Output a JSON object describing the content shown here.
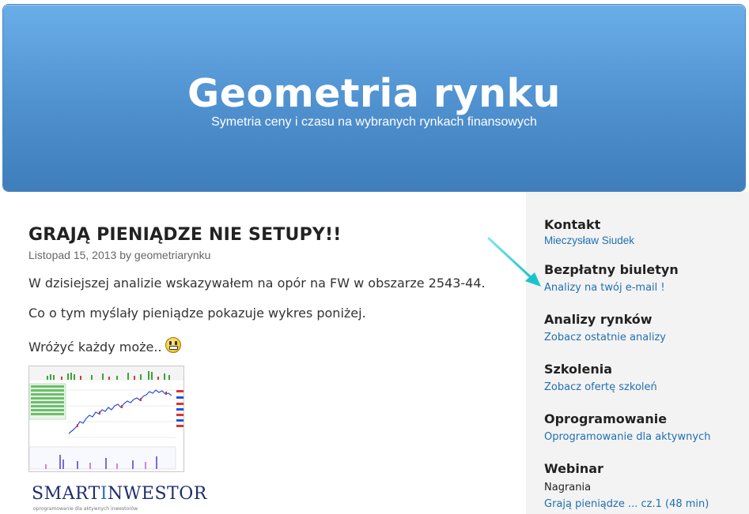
{
  "header": {
    "title": "Geometria rynku",
    "tagline": "Symetria ceny i czasu na wybranych rynkach finansowych"
  },
  "post": {
    "title": "GRAJĄ PIENIĄDZE NIE SETUPY!!",
    "date": "Listopad 15, 2013",
    "by": "by",
    "author": "geometriarynku",
    "paragraphs": [
      "W dzisiejszej analizie wskazywałem na opór na FW w obszarze 2543-44.",
      "Co o tym myślały pieniądze pokazuje wykres poniżej.",
      "Wróżyć każdy może.."
    ],
    "smiley_icon": "grin-smiley-icon",
    "logo": {
      "part1": "SMART",
      "part2": "I",
      "part3": "NWESTOR",
      "subtitle": "oprogramowanie dla aktywnych inwestorów"
    }
  },
  "sidebar": {
    "widgets": [
      {
        "title": "Kontakt",
        "link": "Mieczysław Siudek"
      },
      {
        "title": "Bezpłatny biuletyn",
        "link": "Analizy na twój e-mail !"
      },
      {
        "title": "Analizy rynków",
        "link": "Zobacz ostatnie analizy"
      },
      {
        "title": "Szkolenia",
        "link": "Zobacz ofertę szkoleń"
      },
      {
        "title": "Oprogramowanie",
        "link": "Oprogramowanie dla aktywnych"
      },
      {
        "title": "Webinar",
        "text": "Nagrania",
        "link": "Grają pieniądze ... cz.1 (48 min)"
      }
    ]
  },
  "colors": {
    "header_top": "#6aaee8",
    "header_bottom": "#3f7dbb",
    "link": "#1f6fb2",
    "sidebar_bg": "#f3f3f3",
    "annotation_arrow": "#2ed3d9"
  }
}
